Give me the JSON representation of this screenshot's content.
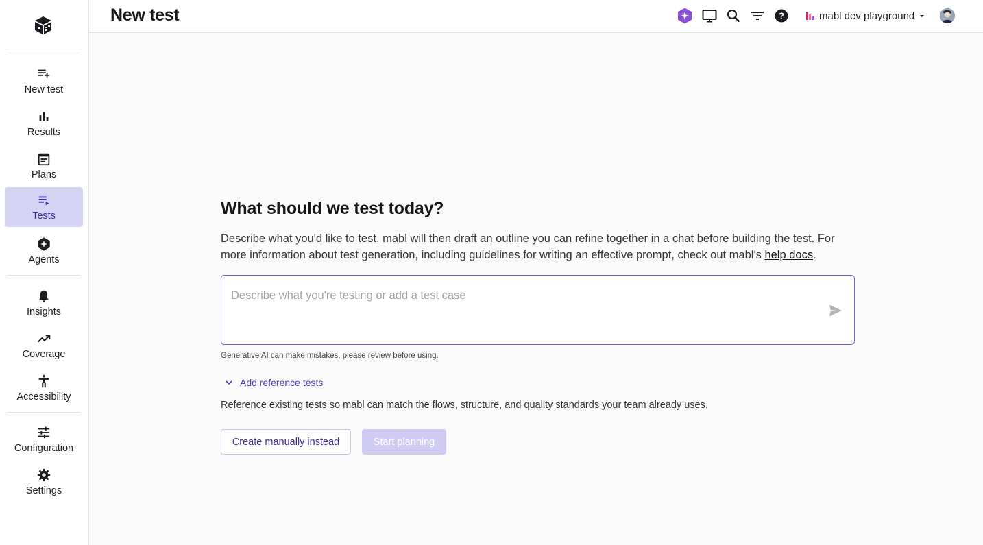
{
  "app": {
    "page_title": "New test",
    "workspace_name": "mabl dev playground"
  },
  "sidebar": {
    "items": [
      {
        "label": "New test",
        "icon": "playlist-add-icon"
      },
      {
        "label": "Results",
        "icon": "bar-chart-icon"
      },
      {
        "label": "Plans",
        "icon": "calendar-plan-icon"
      },
      {
        "label": "Tests",
        "icon": "playlist-play-icon",
        "active": true
      },
      {
        "label": "Agents",
        "icon": "agent-sparkle-icon"
      },
      {
        "label": "Insights",
        "icon": "bell-icon"
      },
      {
        "label": "Coverage",
        "icon": "trending-up-icon"
      },
      {
        "label": "Accessibility",
        "icon": "accessibility-icon"
      },
      {
        "label": "Configuration",
        "icon": "tune-icon"
      },
      {
        "label": "Settings",
        "icon": "gear-icon"
      }
    ]
  },
  "header": {
    "icons": [
      "ai-sparkle-icon",
      "monitor-icon",
      "search-icon",
      "filter-icon",
      "help-icon"
    ]
  },
  "main": {
    "heading": "What should we test today?",
    "description_prefix": "Describe what you'd like to test. mabl will then draft an outline you can refine together in a chat before building the test. For more information about test generation, including guidelines for writing an effective prompt, check out mabl's ",
    "help_link": "help docs",
    "description_suffix": ".",
    "prompt": {
      "value": "",
      "placeholder": "Describe what you're testing or add a test case"
    },
    "disclaimer": "Generative AI can make mistakes, please review before using.",
    "reference_toggle": "Add reference tests",
    "reference_description": "Reference existing tests so mabl can match the flows, structure, and quality standards your team already uses.",
    "create_manually_label": "Create manually instead",
    "start_planning_label": "Start planning"
  },
  "colors": {
    "accent": "#6d5fd4",
    "active_nav_bg": "#d5d3f3",
    "primary_disabled": "#cfcbf2",
    "ai_icon": "#8b4fd8"
  }
}
